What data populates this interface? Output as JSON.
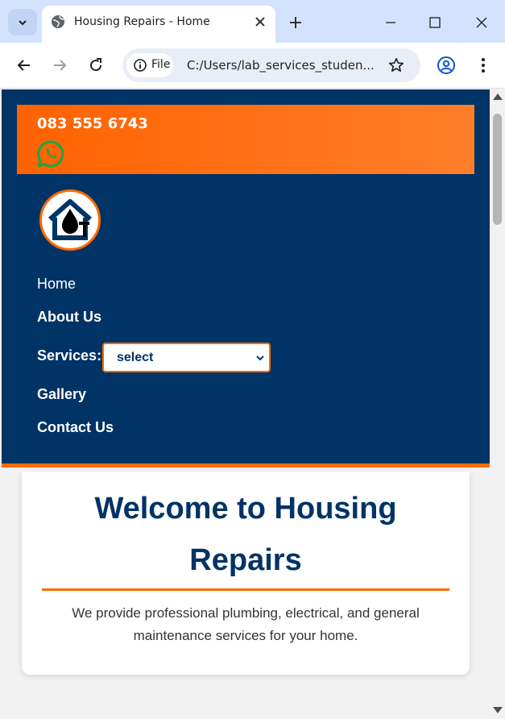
{
  "browser": {
    "tab_title": "Housing Repairs - Home",
    "site_chip_label": "File",
    "url": "C:/Users/lab_services_studen..."
  },
  "header": {
    "phone": "083 555 6743",
    "whatsapp_icon": "whatsapp-icon",
    "logo_icon": "house-water-drop-logo"
  },
  "nav": {
    "home": "Home",
    "about": "About Us",
    "services_label": "Services:",
    "services_selected": "select",
    "gallery": "Gallery",
    "contact": "Contact Us"
  },
  "main": {
    "title": "Welcome to Housing Repairs",
    "intro": "We provide professional plumbing, electrical, and general maintenance services for your home."
  },
  "colors": {
    "navy": "#003366",
    "orange": "#ff6a00",
    "chrome_blue": "#d3e3fd"
  }
}
